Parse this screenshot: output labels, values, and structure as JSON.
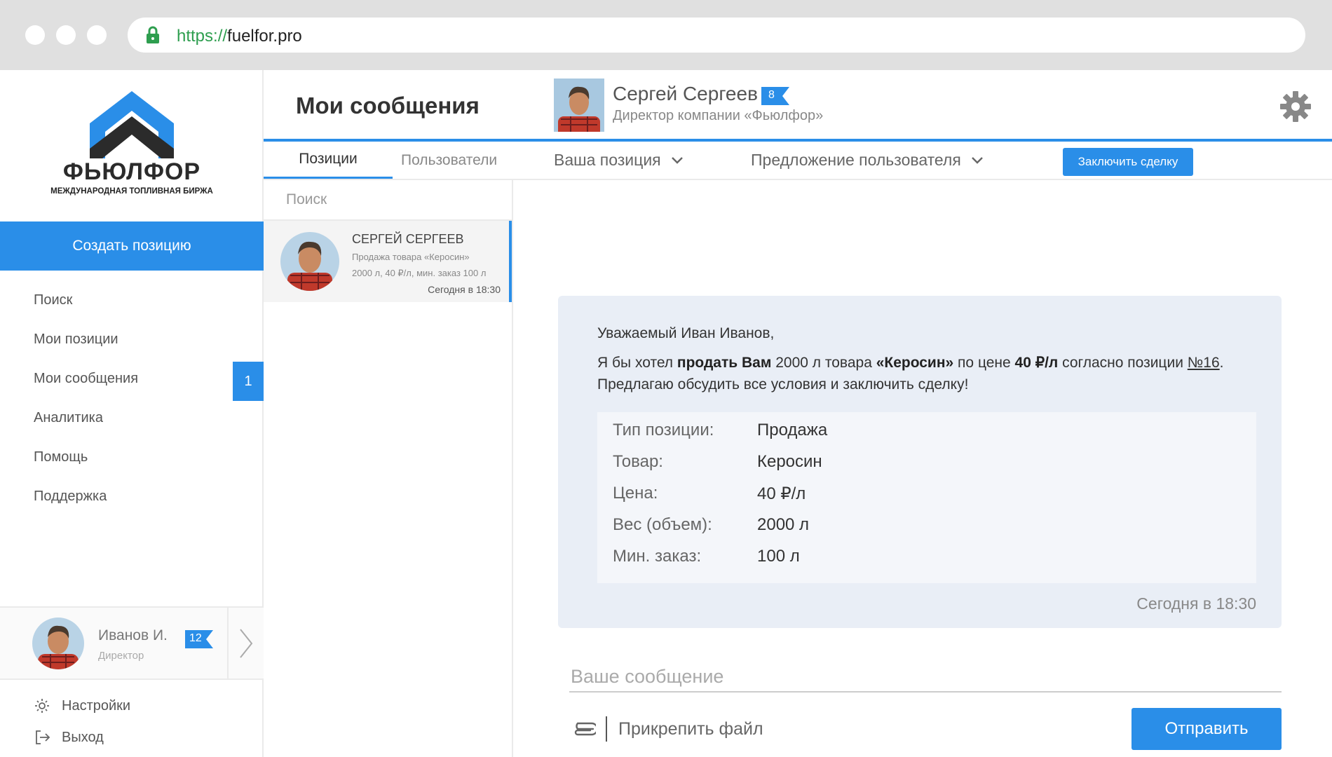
{
  "browser": {
    "url_protocol": "https://",
    "url_domain": "fuelfor.pro"
  },
  "brand": {
    "name": "ФЬЮЛФОР",
    "tagline": "МЕЖДУНАРОДНАЯ ТОПЛИВНАЯ БИРЖА"
  },
  "sidebar": {
    "create_label": "Создать позицию",
    "items": [
      {
        "label": "Поиск"
      },
      {
        "label": "Мои позиции"
      },
      {
        "label": "Мои сообщения",
        "badge": "1"
      },
      {
        "label": "Аналитика"
      },
      {
        "label": "Помощь"
      },
      {
        "label": "Поддержка"
      }
    ],
    "user": {
      "name": "Иванов И.",
      "role": "Директор",
      "badge": "12"
    },
    "settings_label": "Настройки",
    "logout_label": "Выход"
  },
  "header": {
    "title": "Мои сообщения",
    "contact_name": "Сергей Сергеев",
    "contact_title": "Директор компании «Фьюлфор»",
    "contact_badge": "8"
  },
  "tabs": {
    "positions": "Позиции",
    "users": "Пользователи"
  },
  "toolbar": {
    "your_position": "Ваша позиция",
    "user_offer": "Предложение пользователя",
    "deal_label": "Заключить сделку"
  },
  "list": {
    "search_placeholder": "Поиск",
    "conversation": {
      "name": "СЕРГЕЙ СЕРГЕЕВ",
      "line1": "Продажа товара «Керосин»",
      "line2": "2000 л, 40 ₽/л, мин. заказ 100 л",
      "time": "Сегодня в 18:30"
    }
  },
  "message": {
    "greeting": "Уважаемый Иван Иванов,",
    "p1": "Я бы хотел ",
    "p1_bold": "продать Вам",
    "p2": " 2000 л товара ",
    "p2_bold": "«Керосин»",
    "p3": " по цене ",
    "p3_bold": "40 ₽/л",
    "p4": " согласно позиции ",
    "p4_link": "№16",
    "p5": ".",
    "line2": "Предлагаю обсудить все условия и заключить сделку!",
    "details": [
      {
        "label": "Тип позиции:",
        "value": "Продажа"
      },
      {
        "label": "Товар:",
        "value": "Керосин"
      },
      {
        "label": "Цена:",
        "value": "40 ₽/л"
      },
      {
        "label": "Вес (объем):",
        "value": "2000 л"
      },
      {
        "label": "Мин. заказ:",
        "value": "100 л"
      }
    ],
    "time": "Сегодня в 18:30"
  },
  "compose": {
    "placeholder": "Ваше сообщение",
    "attach_label": "Прикрепить файл",
    "send_label": "Отправить"
  },
  "colors": {
    "accent": "#2a8ee8",
    "logo_dark": "#2b2b2b",
    "logo_blue": "#2a8ee8"
  }
}
